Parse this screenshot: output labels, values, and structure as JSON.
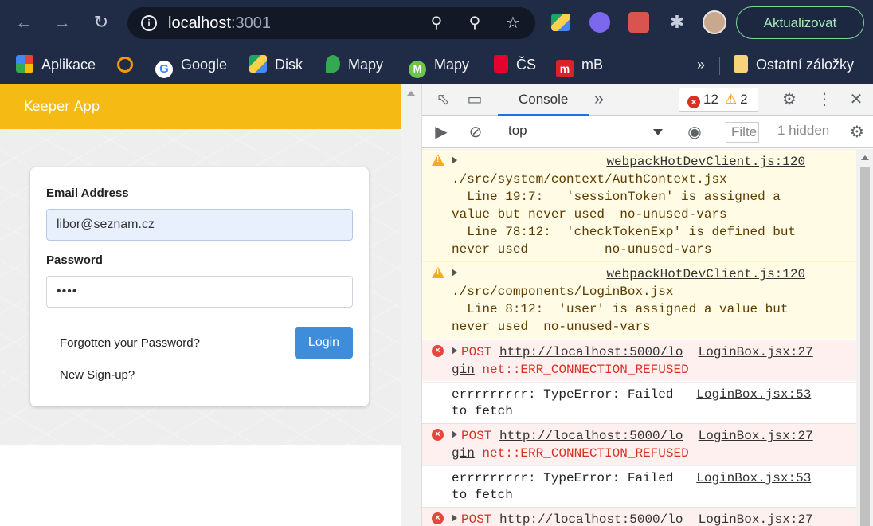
{
  "browser": {
    "url_host": "localhost",
    "url_port": ":3001",
    "update_label": "Aktualizovat",
    "bookmarks": [
      {
        "label": "Aplikace",
        "icon": "apps-grid-icon"
      },
      {
        "label": "",
        "icon": "search-q-icon"
      },
      {
        "label": "Google",
        "icon": "google-icon"
      },
      {
        "label": "Disk",
        "icon": "drive-icon"
      },
      {
        "label": "Mapy",
        "icon": "maps-pin-icon"
      },
      {
        "label": "Mapy",
        "icon": "mapy-cz-icon"
      },
      {
        "label": "ČS",
        "icon": "cs-bank-icon"
      },
      {
        "label": "mB",
        "icon": "mbank-icon"
      }
    ],
    "bookmarks_overflow": "»",
    "other_bookmarks": "Ostatní záložky"
  },
  "page": {
    "app_title": "Keeper App",
    "email_label": "Email Address",
    "email_value": "libor@seznam.cz",
    "password_label": "Password",
    "password_value": "••••",
    "forgot_link": "Forgotten your Password?",
    "signup_link": "New Sign-up?",
    "login_button": "Login"
  },
  "devtools": {
    "tab_console": "Console",
    "more_tabs": "»",
    "error_count": "12",
    "warning_count": "2",
    "context": "top",
    "filter_placeholder": "Filte",
    "hidden_count": "1 hidden",
    "messages": [
      {
        "type": "warning",
        "source": "webpackHotDevClient.js:120",
        "lines": [
          "./src/system/context/AuthContext.jsx",
          "  Line 19:7:   'sessionToken' is assigned a",
          "value but never used  no-unused-vars",
          "  Line 78:12:  'checkTokenExp' is defined but",
          "never used          no-unused-vars"
        ]
      },
      {
        "type": "warning",
        "source": "webpackHotDevClient.js:120",
        "lines": [
          "./src/components/LoginBox.jsx",
          "  Line 8:12:  'user' is assigned a value but",
          "never used  no-unused-vars"
        ]
      },
      {
        "type": "error",
        "method": "POST",
        "url_1": "http://localhost:5000/lo",
        "url_2": "gin",
        "error": "net::ERR_CONNECTION_REFUSED",
        "source": "LoginBox.jsx:27"
      },
      {
        "type": "log",
        "line_1": "errrrrrrrr: TypeError: Failed",
        "line_2": "to fetch",
        "source": "LoginBox.jsx:53"
      },
      {
        "type": "error",
        "method": "POST",
        "url_1": "http://localhost:5000/lo",
        "url_2": "gin",
        "error": "net::ERR_CONNECTION_REFUSED",
        "source": "LoginBox.jsx:27"
      },
      {
        "type": "log",
        "line_1": "errrrrrrrr: TypeError: Failed",
        "line_2": "to fetch",
        "source": "LoginBox.jsx:53"
      },
      {
        "type": "error",
        "method": "POST",
        "url_1": "http://localhost:5000/lo",
        "url_2": "",
        "error": "",
        "source": "LoginBox.jsx:27"
      }
    ]
  }
}
